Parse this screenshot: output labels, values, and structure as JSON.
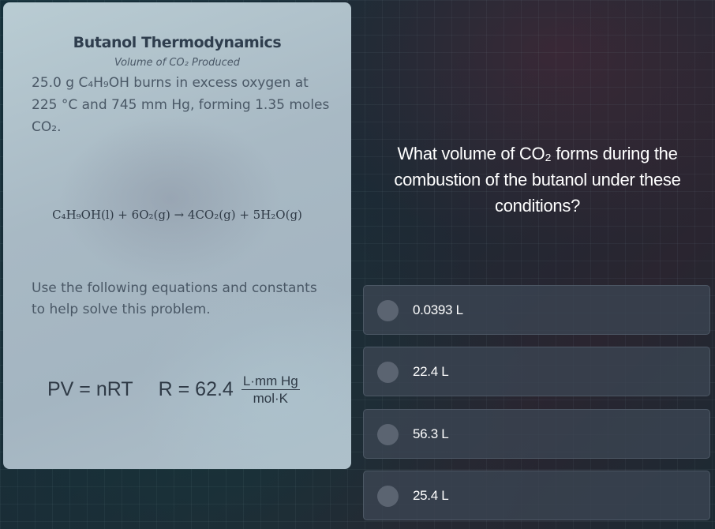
{
  "card": {
    "title": "Butanol Thermodynamics",
    "subtitle": "Volume of CO₂ Produced",
    "problem": "25.0 g C₄H₉OH burns in excess oxygen at 225 °C and 745 mm Hg, forming 1.35 moles CO₂.",
    "equation": "C₄H₉OH(l) + 6O₂(g) → 4CO₂(g) + 5H₂O(g)",
    "hint": "Use the following equations and constants to help solve this problem.",
    "formula": {
      "ideal_gas": "PV = nRT",
      "r_value": "R = 62.4",
      "r_unit_numerator": "L·mm Hg",
      "r_unit_denominator": "mol·K"
    }
  },
  "question": "What volume of CO₂ forms during the combustion of the butanol under these conditions?",
  "options": [
    {
      "label": "0.0393 L",
      "selected": false
    },
    {
      "label": "22.4 L",
      "selected": false
    },
    {
      "label": "56.3 L",
      "selected": false
    },
    {
      "label": "25.4 L",
      "selected": false
    }
  ]
}
